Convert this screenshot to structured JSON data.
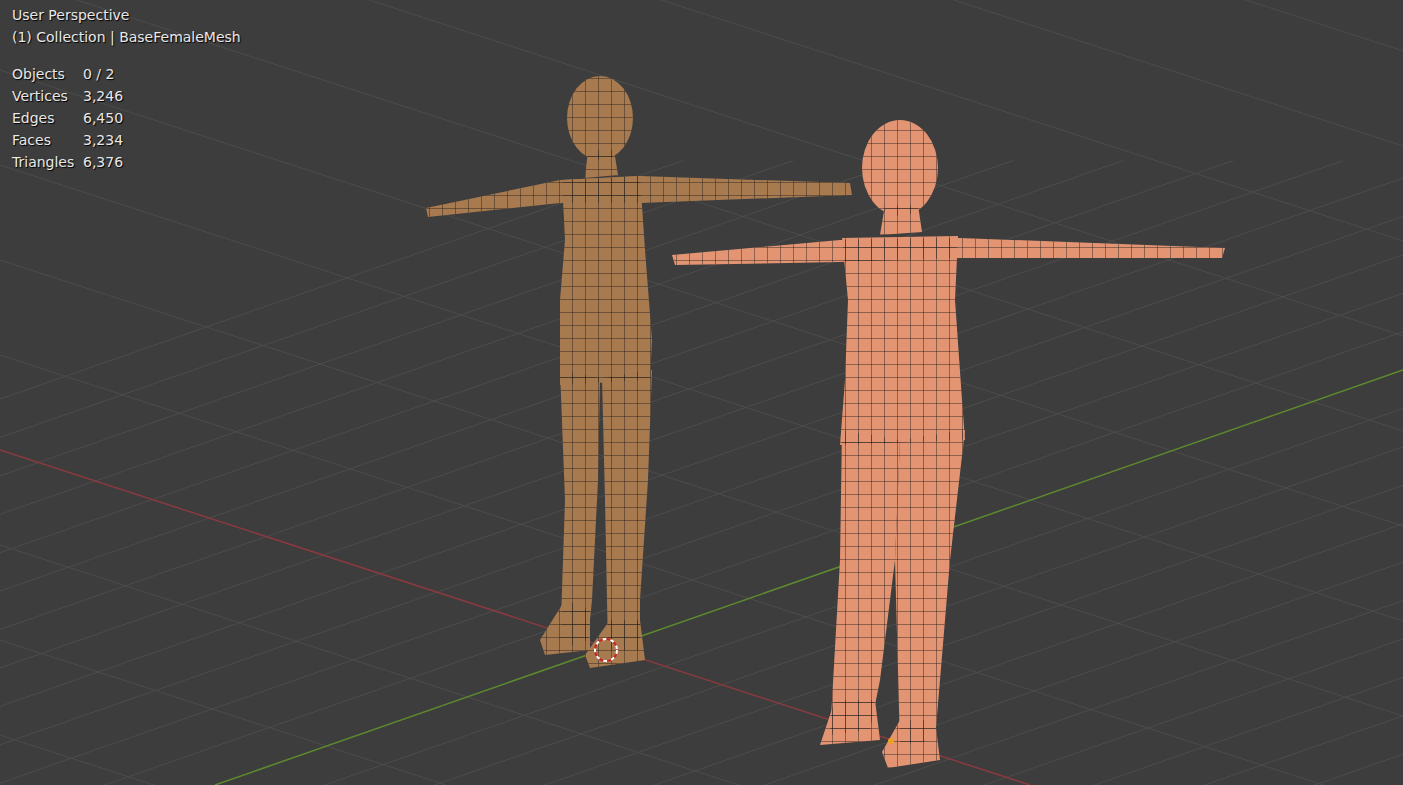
{
  "viewport": {
    "view": "User Perspective",
    "collection": "(1) Collection | BaseFemaleMesh"
  },
  "stats": [
    {
      "label": "Objects",
      "value": "0 / 2"
    },
    {
      "label": "Vertices",
      "value": "3,246"
    },
    {
      "label": "Edges",
      "value": "6,450"
    },
    {
      "label": "Faces",
      "value": "3,234"
    },
    {
      "label": "Triangles",
      "value": "6,376"
    }
  ]
}
